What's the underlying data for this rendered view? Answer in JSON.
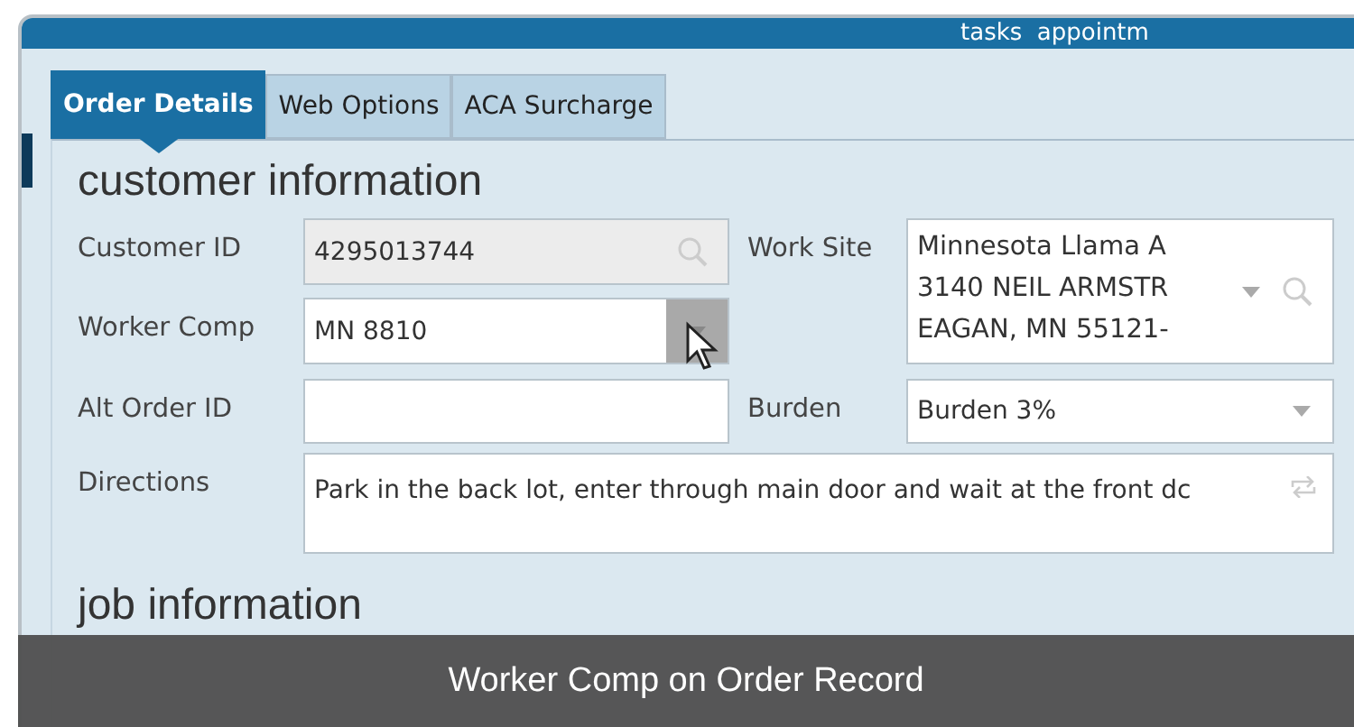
{
  "toolbar": {
    "text": "tasks  appointm"
  },
  "tabs": [
    {
      "label": "Order Details",
      "selected": true
    },
    {
      "label": "Web Options",
      "selected": false
    },
    {
      "label": "ACA Surcharge",
      "selected": false
    }
  ],
  "customer_information": {
    "title": "customer information",
    "left_column": [
      {
        "label": "Customer ID",
        "kind": "lookup",
        "value": "4295013744"
      },
      {
        "label": "Worker Comp",
        "kind": "dropdown",
        "value": "MN 8810",
        "hovered": true
      },
      {
        "label": "Alt Order ID",
        "kind": "text"
      }
    ],
    "right_column": [
      {
        "label": "Work Site",
        "kind": "address",
        "lines": [
          "Minnesota Llama A",
          "3140 NEIL ARMSTR",
          "EAGAN, MN 55121-"
        ]
      },
      {
        "label": "Burden",
        "kind": "dropdown",
        "value": "Burden 3%",
        "hovered": false
      }
    ],
    "directions": {
      "label": "Directions",
      "kind": "textarea",
      "value": "Park in the back lot, enter through main door and wait at the front dc"
    }
  },
  "job_information": {
    "title": "job information"
  },
  "caption": "Worker Comp on Order Record"
}
